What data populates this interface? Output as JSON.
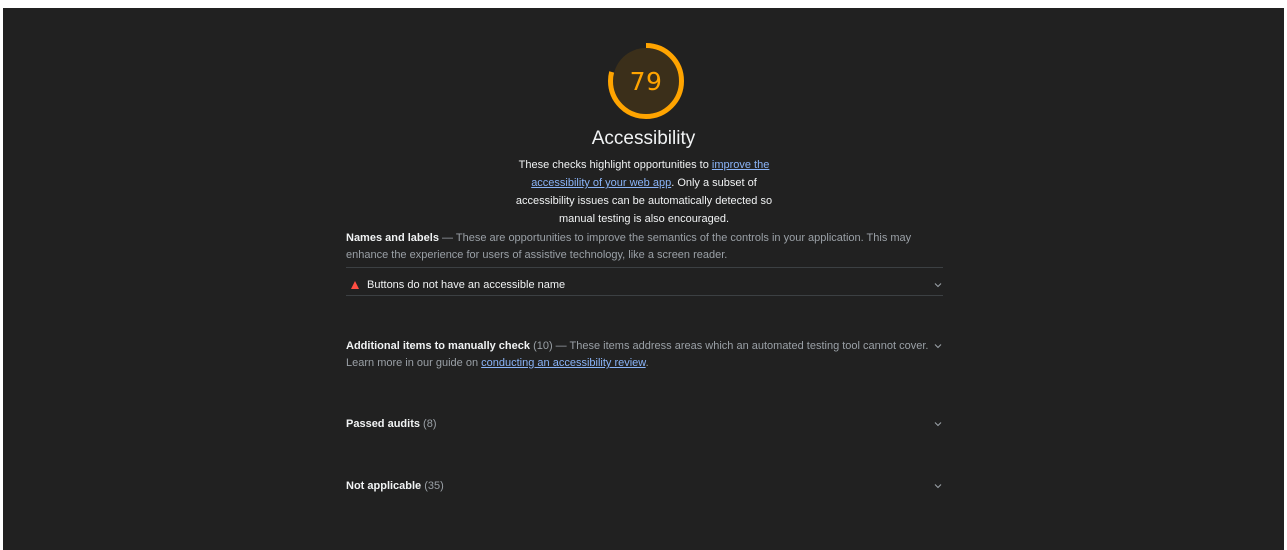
{
  "category": {
    "score": "79",
    "score_fraction": 0.79,
    "title": "Accessibility",
    "desc_pre": "These checks highlight opportunities to ",
    "desc_link": "improve the accessibility of your web app",
    "desc_post": ". Only a subset of accessibility issues can be automatically detected so manual testing is also encouraged."
  },
  "names_group": {
    "title": "Names and labels",
    "separator": " — ",
    "description": "These are opportunities to improve the semantics of the controls in your application. This may enhance the experience for users of assistive technology, like a screen reader."
  },
  "failed_audit": {
    "label": "Buttons do not have an accessible name"
  },
  "manual_group": {
    "title": "Additional items to manually check",
    "count": "(10)",
    "separator": " — ",
    "description": "These items address areas which an automated testing tool cannot cover. Learn more in our guide on ",
    "link": "conducting an accessibility review",
    "end": "."
  },
  "passed_group": {
    "title": "Passed audits",
    "count": "(8)"
  },
  "not_applicable_group": {
    "title": "Not applicable",
    "count": "(35)"
  },
  "colors": {
    "background": "#212121",
    "gauge_average": "#ffa400",
    "fail": "#ff4e42",
    "link": "#8ab4f8"
  },
  "icons": {
    "failed_audit": "fail-triangle-icon",
    "expand": "chevron-down-icon"
  }
}
